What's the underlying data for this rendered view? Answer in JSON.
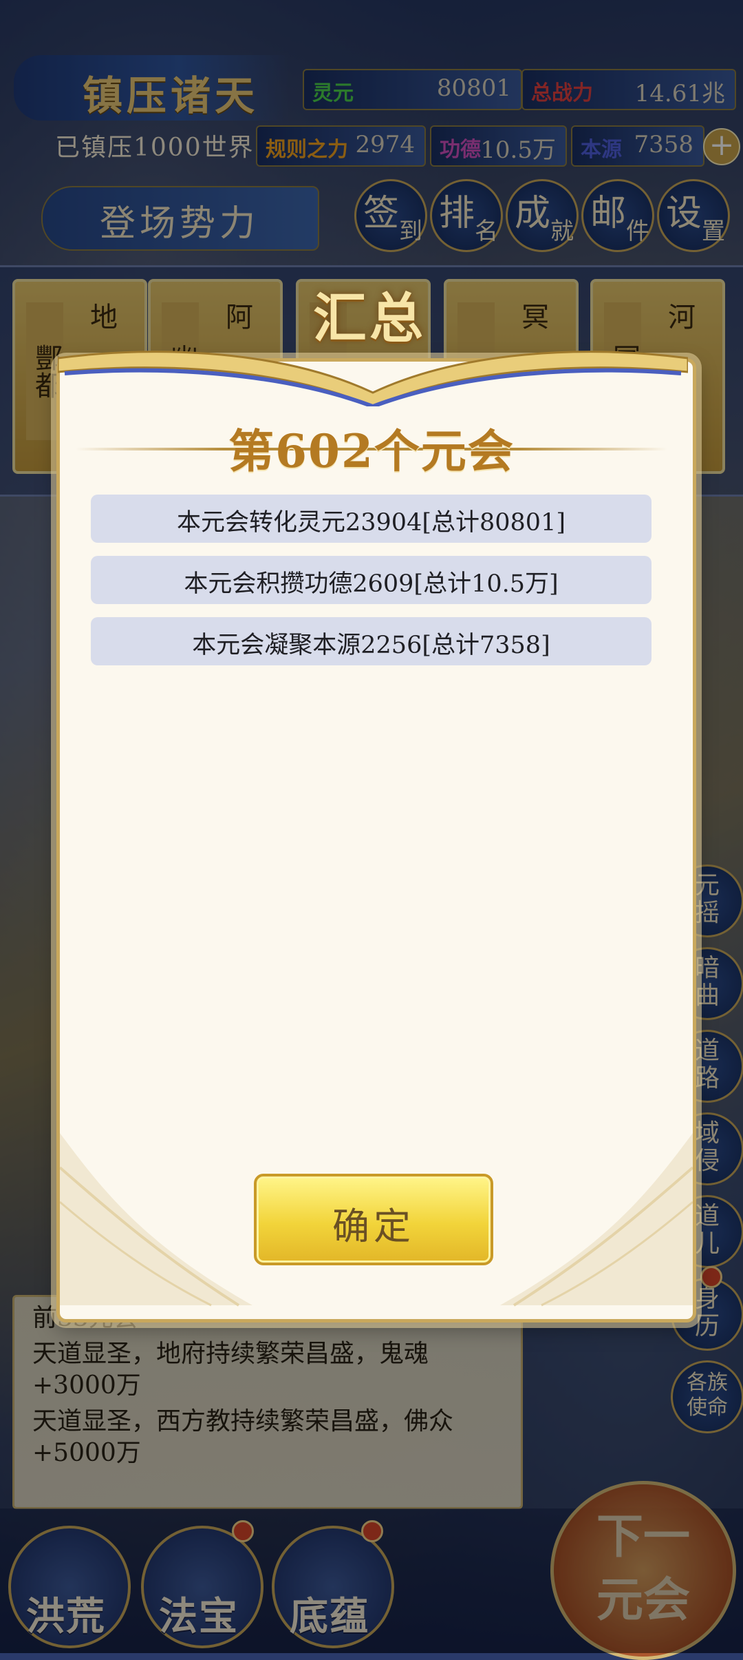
{
  "header": {
    "title": "镇压诸天",
    "subtitle": "已镇压1000世界",
    "stats": {
      "lingyuan_label": "灵元",
      "lingyuan_value": "80801",
      "zongzhanli_label": "总战力",
      "zongzhanli_value": "14.61兆",
      "guize_label": "规则之力",
      "guize_value": "2974",
      "gongde_label": "功德",
      "gongde_value": "10.5万",
      "benyuan_label": "本源",
      "benyuan_value": "7358"
    },
    "forces_button": "登场势力",
    "nav": [
      {
        "a": "签",
        "b": "到"
      },
      {
        "a": "排",
        "b": "名"
      },
      {
        "a": "成",
        "b": "就"
      },
      {
        "a": "邮",
        "b": "件"
      },
      {
        "a": "设",
        "b": "置"
      }
    ]
  },
  "characters": [
    {
      "name1": "酆都",
      "name2": "地"
    },
    {
      "name1": "幽",
      "name2": "阿"
    },
    {
      "name1": "",
      "name2": ""
    },
    {
      "name1": "",
      "name2": "冥"
    },
    {
      "name1": "冥",
      "name2": "河"
    }
  ],
  "side_buttons": [
    "元\n摇",
    "暗\n曲",
    "道\n路",
    "域\n侵",
    "道\n儿",
    "身\n历",
    "各族\n使命"
  ],
  "log": {
    "lines": [
      "前33元会",
      "天道显圣，地府持续繁荣昌盛，鬼魂",
      "+3000万",
      "天道显圣，西方教持续繁荣昌盛，佛众",
      "+5000万"
    ]
  },
  "bottom_nav": [
    "洪荒",
    "法宝",
    "底蕴"
  ],
  "next_button": "下一\n元会",
  "modal": {
    "title": "汇总",
    "era": "第602个元会",
    "rows": [
      "本元会转化灵元23904[总计80801]",
      "本元会积攒功德2609[总计10.5万]",
      "本元会凝聚本源2256[总计7358]"
    ],
    "confirm": "确定"
  },
  "colors": {
    "gold": "#c9a85c",
    "lingyuan": "#4cd24c",
    "zhanli": "#e04040",
    "guize": "#f0a020",
    "gongde": "#d050c0",
    "benyuan": "#5060e0"
  }
}
